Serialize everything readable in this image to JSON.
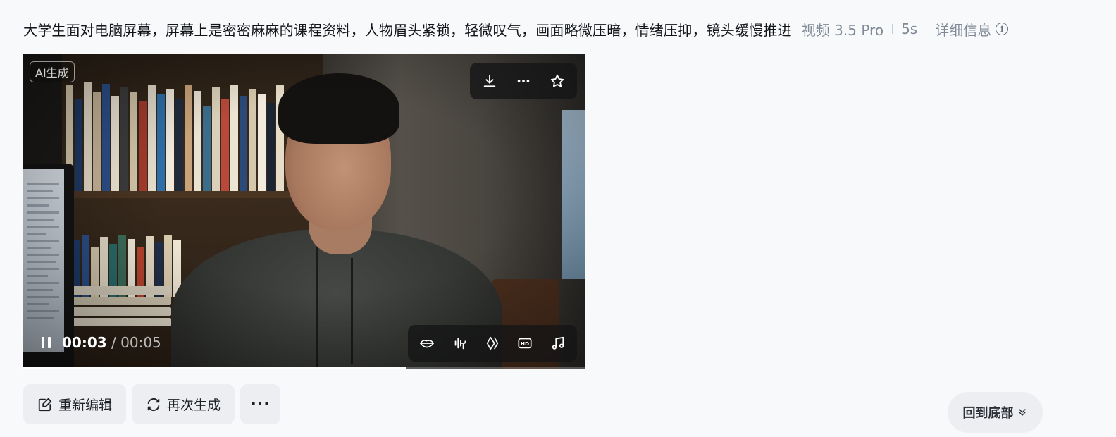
{
  "header": {
    "prompt": "大学生面对电脑屏幕，屏幕上是密密麻麻的课程资料，人物眉头紧锁，轻微叹气，画面略微压暗，情绪压抑，镜头缓慢推进",
    "model": "视频 3.5 Pro",
    "duration": "5s",
    "detail_label": "详细信息"
  },
  "video": {
    "badge": "AI生成",
    "current_time": "00:03",
    "total_time": " / 00:05",
    "progress": 0.68,
    "top_actions": [
      "download-icon",
      "more-icon",
      "star-icon"
    ],
    "tools": [
      "lips-icon",
      "audio-wave-icon",
      "diamond-icon",
      "hd-icon",
      "music-note-icon"
    ],
    "hd_text": "HD"
  },
  "actions": {
    "reedit_label": "重新编辑",
    "regenerate_label": "再次生成",
    "more_label": "···"
  },
  "back_to_bottom": "回到底部"
}
